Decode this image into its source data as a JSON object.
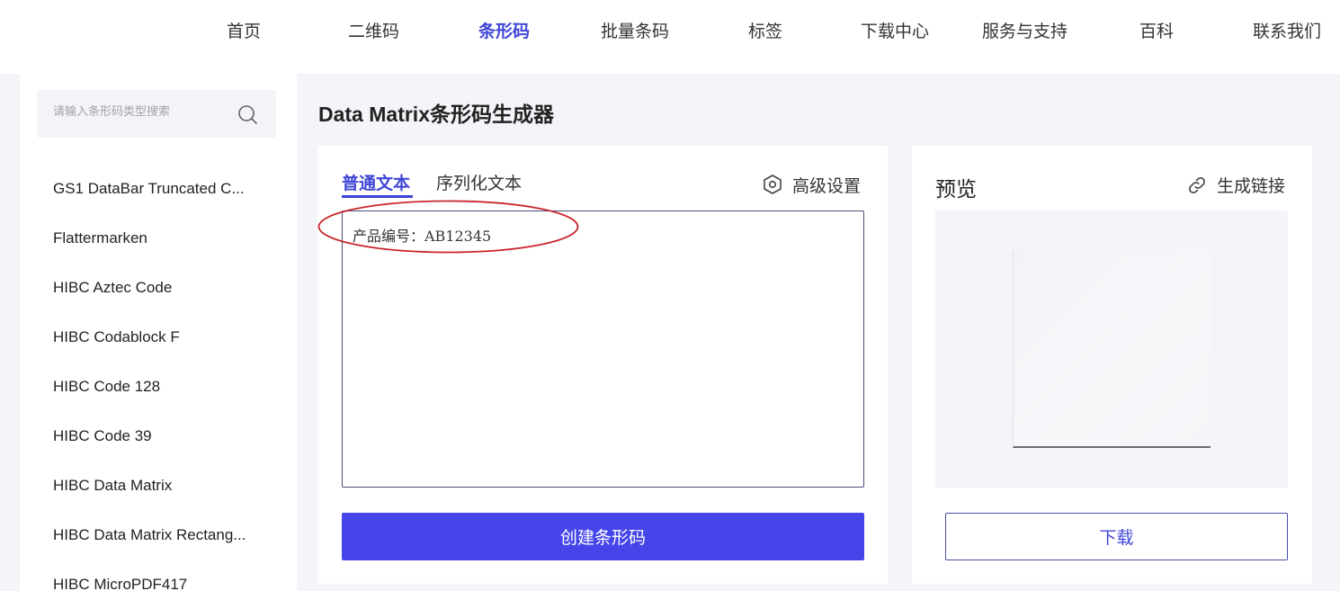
{
  "nav": {
    "items": [
      {
        "label": "首页"
      },
      {
        "label": "二维码"
      },
      {
        "label": "条形码"
      },
      {
        "label": "批量条码"
      },
      {
        "label": "标签"
      },
      {
        "label": "下载中心"
      },
      {
        "label": "服务与支持"
      },
      {
        "label": "百科"
      },
      {
        "label": "联系我们"
      }
    ],
    "active": "条形码"
  },
  "sidebar": {
    "search_placeholder": "请输入条形码类型搜索",
    "items": [
      {
        "label": "GS1 DataBar Truncated C..."
      },
      {
        "label": "Flattermarken"
      },
      {
        "label": "HIBC Aztec Code"
      },
      {
        "label": "HIBC Codablock F"
      },
      {
        "label": "HIBC Code 128"
      },
      {
        "label": "HIBC Code 39"
      },
      {
        "label": "HIBC Data Matrix"
      },
      {
        "label": "HIBC Data Matrix Rectang..."
      },
      {
        "label": "HIBC MicroPDF417"
      }
    ]
  },
  "page_title": "Data Matrix条形码生成器",
  "editor": {
    "tabs": [
      {
        "label": "普通文本"
      },
      {
        "label": "序列化文本"
      }
    ],
    "active_tab": "普通文本",
    "advanced_settings_label": "高级设置",
    "input_value": "产品编号：AB12345",
    "create_button_label": "创建条形码"
  },
  "preview": {
    "title": "预览",
    "generate_link_label": "生成链接",
    "download_button_label": "下载"
  },
  "colors": {
    "accent": "#3f46d6",
    "button_fill": "#4545ea",
    "annotation": "#c8262b",
    "background": "#f3f5f9"
  }
}
